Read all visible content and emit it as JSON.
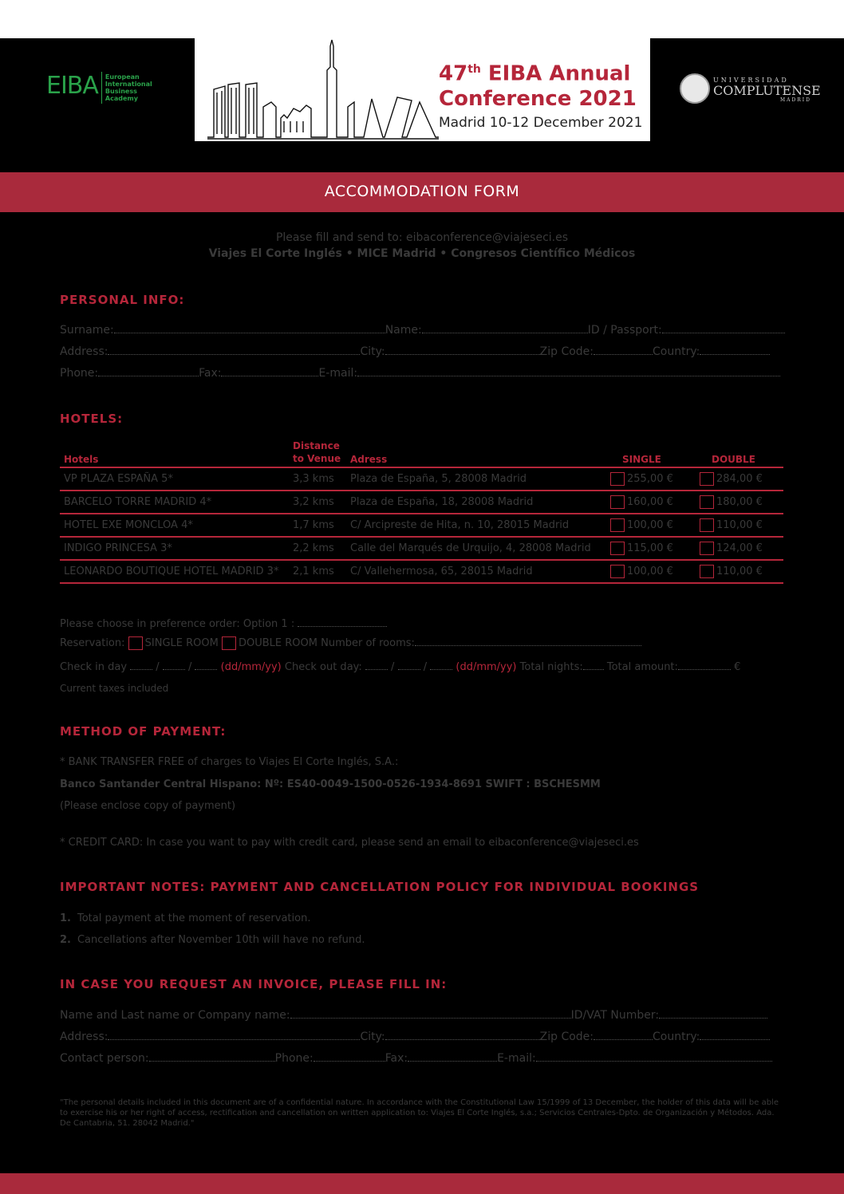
{
  "header": {
    "conference_title_line1_num": "47",
    "conference_title_line1_sup": "th",
    "conference_title_line1_rest": " EIBA Annual",
    "conference_title_line2": "Conference 2021",
    "conference_subtitle": "Madrid 10-12 December 2021",
    "eiba_logo_word": "EIBA",
    "eiba_logo_desc": [
      "European",
      "International",
      "Business",
      "Academy"
    ],
    "ucm_logo_line1": "UNIVERSIDAD",
    "ucm_logo_line2": "COMPLUTENSE",
    "ucm_logo_line3": "MADRID"
  },
  "form_title": "ACCOMMODATION FORM",
  "send_line1": "Please fill and send to: eibaconference@viajeseci.es",
  "send_line2": "Viajes El Corte Inglés • MICE Madrid • Congresos Científico Médicos",
  "personal": {
    "heading": "PERSONAL INFO:",
    "surname": "Surname:",
    "name": "Name:",
    "id": "ID / Passport:",
    "address": "Address:",
    "city": "City:",
    "zip": "Zip Code:",
    "country": "Country:",
    "phone": "Phone:",
    "fax": "Fax:",
    "email": "E-mail:"
  },
  "hotels": {
    "heading": "HOTELS:",
    "columns": {
      "hotels": "Hotels",
      "distance_line1": "Distance",
      "distance_line2": "to Venue",
      "address": "Adress",
      "single": "SINGLE",
      "double": "DOUBLE"
    },
    "rows": [
      {
        "name": "VP PLAZA ESPAÑA 5*",
        "distance": "3,3 kms",
        "address": "Plaza de España, 5, 28008 Madrid",
        "single": "255,00 €",
        "double": "284,00 €"
      },
      {
        "name": "BARCELO TORRE MADRID 4*",
        "distance": "3,2 kms",
        "address": "Plaza de España, 18, 28008 Madrid",
        "single": "160,00 €",
        "double": "180,00 €"
      },
      {
        "name": "HOTEL EXE MONCLOA 4*",
        "distance": "1,7 kms",
        "address": "C/ Arcipreste de Hita, n. 10, 28015 Madrid",
        "single": "100,00 €",
        "double": "110,00 €"
      },
      {
        "name": "INDIGO PRINCESA 3*",
        "distance": "2,2 kms",
        "address": "Calle del Marqués de Urquijo, 4, 28008 Madrid",
        "single": "115,00 €",
        "double": "124,00 €"
      },
      {
        "name": "LEONARDO BOUTIQUE HOTEL MADRID 3*",
        "distance": "2,1 kms",
        "address": "C/ Vallehermosa, 65, 28015 Madrid",
        "single": "100,00 €",
        "double": "110,00 €"
      }
    ]
  },
  "reservation": {
    "preference": "Please choose in preference order: Option 1 :",
    "reservation_label": "Reservation:",
    "single_room": "SINGLE ROOM",
    "double_room": "DOUBLE ROOM",
    "number_rooms": "Number of rooms:",
    "checkin_label": "Check in day",
    "date_format1": "(dd/mm/yy)",
    "checkout_label": "Check out day:",
    "date_format2": "(dd/mm/yy)",
    "total_nights": "Total nights:",
    "total_amount": "Total amount:",
    "euro": "€",
    "taxes": "Current taxes included"
  },
  "payment": {
    "heading": "METHOD OF PAYMENT:",
    "bank_transfer": "* BANK TRANSFER FREE of charges to Viajes El Corte Inglés, S.A.:",
    "bank_details": "Banco Santander Central Hispano: Nº: ES40-0049-1500-0526-1934-8691  SWIFT : BSCHESMM",
    "enclose": "(Please enclose copy of payment)",
    "credit_card": "* CREDIT CARD: In case you want to pay with credit card, please send an email to eibaconference@viajeseci.es"
  },
  "notes": {
    "heading": "IMPORTANT NOTES: PAYMENT AND CANCELLATION POLICY FOR INDIVIDUAL BOOKINGS",
    "items": [
      {
        "num": "1.",
        "text": "Total payment at the moment of reservation."
      },
      {
        "num": "2.",
        "text": "Cancellations after November 10th will have no refund."
      }
    ]
  },
  "invoice": {
    "heading": "IN CASE YOU REQUEST AN INVOICE, PLEASE FILL IN:",
    "name_company": "Name and Last name or Company name:",
    "vat": "ID/VAT Number:",
    "address": "Address:",
    "city": "City:",
    "zip": "Zip Code:",
    "country": "Country:",
    "contact": "Contact person:",
    "phone": "Phone:",
    "fax": "Fax:",
    "email": "E-mail:"
  },
  "footer_note": "\"The personal details included in this document are of a confidential nature. In accordance with the Constitutional Law 15/1999 of 13 December, the holder of this data will be able to exercise his or her right of access, rectification and cancellation on written application to: Viajes El Corte Inglés, s.a.; Servicios Centrales-Dpto. de Organización y Métodos. Ada. De Cantabria, 51. 28042 Madrid.\""
}
